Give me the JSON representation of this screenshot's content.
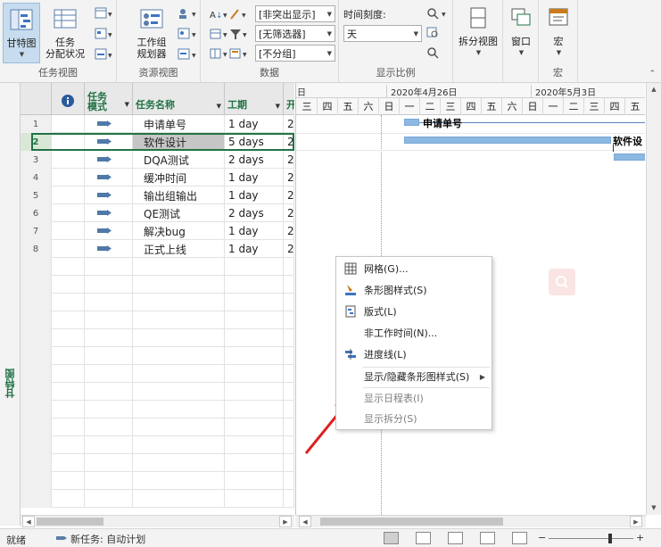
{
  "ribbon": {
    "task_view": {
      "label": "任务视图",
      "gantt_button": "甘特图",
      "task_usage_button": "任务\n分配状况"
    },
    "resource_view": {
      "label": "资源视图",
      "team_planner_button": "工作组\n规划器"
    },
    "data": {
      "label": "数据",
      "highlight_combo": "[非突出显示]",
      "filter_combo": "[无筛选器]",
      "group_combo": "[不分组]"
    },
    "zoom": {
      "label": "显示比例",
      "timescale_label": "时间刻度:",
      "timescale_combo": "天"
    },
    "split_view": {
      "button": "拆分视图"
    },
    "window": {
      "button": "窗口"
    },
    "macros": {
      "label": "宏",
      "button": "宏"
    }
  },
  "side_label": "甘特图",
  "table": {
    "headers": {
      "mode": "任务\n模式",
      "name": "任务名称",
      "duration": "工期",
      "start": "开"
    },
    "rows": [
      {
        "num": "1",
        "name": "申请单号",
        "duration": "1 day",
        "start": "2"
      },
      {
        "num": "2",
        "name": "软件设计",
        "duration": "5 days",
        "start": "2"
      },
      {
        "num": "3",
        "name": "DQA测试",
        "duration": "2 days",
        "start": "2"
      },
      {
        "num": "4",
        "name": "缓冲时间",
        "duration": "1 day",
        "start": "2"
      },
      {
        "num": "5",
        "name": "输出组输出",
        "duration": "1 day",
        "start": "2"
      },
      {
        "num": "6",
        "name": "QE测试",
        "duration": "2 days",
        "start": "2"
      },
      {
        "num": "7",
        "name": "解决bug",
        "duration": "1 day",
        "start": "2"
      },
      {
        "num": "8",
        "name": "正式上线",
        "duration": "1 day",
        "start": "2"
      }
    ]
  },
  "gantt": {
    "week_labels": [
      "日",
      "2020年4月26日",
      "2020年5月3日"
    ],
    "days": [
      "三",
      "四",
      "五",
      "六",
      "日",
      "一",
      "二",
      "三",
      "四",
      "五",
      "六",
      "日",
      "一",
      "二",
      "三",
      "四",
      "五"
    ],
    "bar_labels": [
      "申请单号",
      "软件设"
    ]
  },
  "context_menu": {
    "items": [
      "网格(G)...",
      "条形图样式(S)",
      "版式(L)",
      "非工作时间(N)...",
      "进度线(L)",
      "显示/隐藏条形图样式(S)",
      "显示日程表(I)",
      "显示拆分(S)"
    ]
  },
  "status_bar": {
    "ready": "就绪",
    "new_tasks": "新任务: 自动计划"
  },
  "colors": {
    "accent": "#217346",
    "bar": "#8cb8e2",
    "arrow": "#e02020"
  }
}
